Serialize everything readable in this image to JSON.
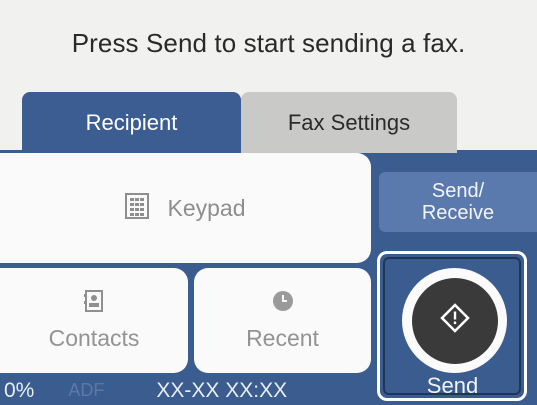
{
  "prompt": "Press Send to start sending a fax.",
  "tabs": {
    "recipient": "Recipient",
    "fax_settings": "Fax Settings"
  },
  "buttons": {
    "keypad": "Keypad",
    "contacts": "Contacts",
    "recent": "Recent",
    "send_receive": "Send/\nReceive",
    "send": "Send"
  },
  "status": {
    "progress": "0%",
    "source": "ADF",
    "datetime": "XX-XX XX:XX"
  },
  "colors": {
    "accent": "#3b5c8f",
    "tab_inactive": "#c9c9c7",
    "send_button": "#3a3a3a"
  },
  "icons": {
    "keypad": "keypad-icon",
    "contacts": "contacts-icon",
    "recent": "clock-icon",
    "send": "diamond-start-icon"
  }
}
